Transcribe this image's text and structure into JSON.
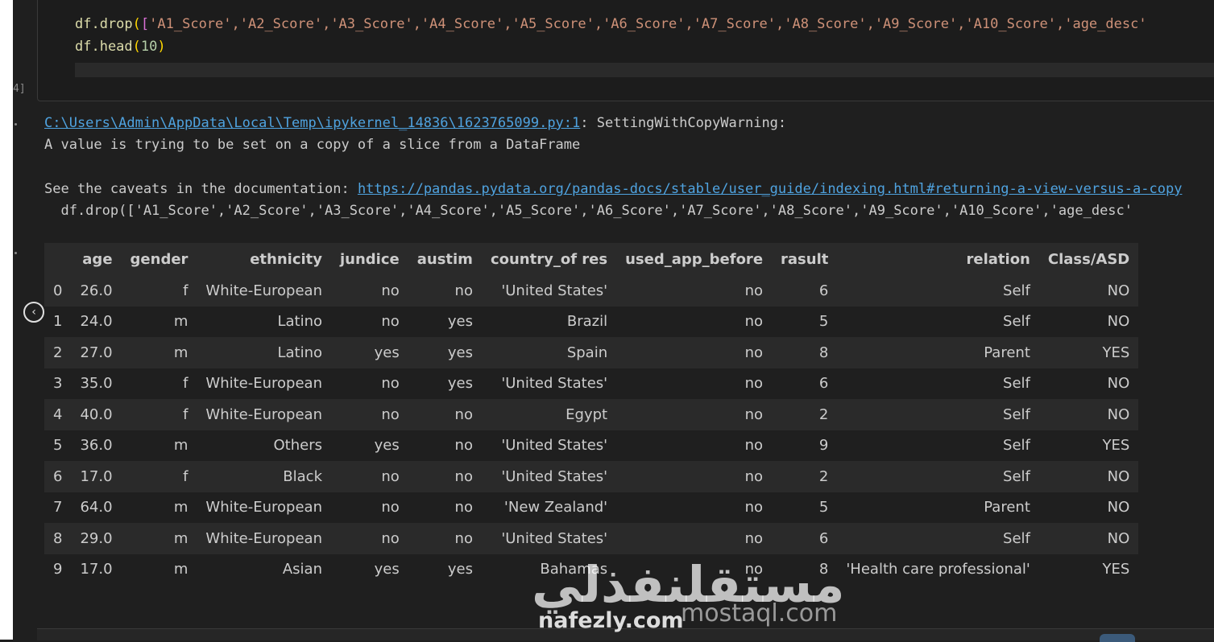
{
  "code": {
    "line1_fn": "df.drop",
    "line1_args": "'A1_Score','A2_Score','A3_Score','A4_Score','A5_Score','A6_Score','A7_Score','A8_Score','A9_Score','A10_Score','age_desc'",
    "line2_fn": "df.head",
    "line2_arg": "10"
  },
  "execution_count": "4]",
  "output": {
    "warning_link": "C:\\Users\\Admin\\AppData\\Local\\Temp\\ipykernel_14836\\1623765099.py:1",
    "warning_title": ": SettingWithCopyWarning:",
    "warning_msg": "A value is trying to be set on a copy of a slice from a DataFrame",
    "caveats_text": "See the caveats in the documentation: ",
    "caveats_link": "https://pandas.pydata.org/pandas-docs/stable/user_guide/indexing.html#returning-a-view-versus-a-copy",
    "source_line": "  df.drop(['A1_Score','A2_Score','A3_Score','A4_Score','A5_Score','A6_Score','A7_Score','A8_Score','A9_Score','A10_Score','age_desc'"
  },
  "table": {
    "columns": [
      "",
      "age",
      "gender",
      "ethnicity",
      "jundice",
      "austim",
      "country_of res",
      "used_app_before",
      "rasult",
      "relation",
      "Class/ASD"
    ],
    "rows": [
      [
        "0",
        "26.0",
        "f",
        "White-European",
        "no",
        "no",
        "'United States'",
        "no",
        "6",
        "Self",
        "NO"
      ],
      [
        "1",
        "24.0",
        "m",
        "Latino",
        "no",
        "yes",
        "Brazil",
        "no",
        "5",
        "Self",
        "NO"
      ],
      [
        "2",
        "27.0",
        "m",
        "Latino",
        "yes",
        "yes",
        "Spain",
        "no",
        "8",
        "Parent",
        "YES"
      ],
      [
        "3",
        "35.0",
        "f",
        "White-European",
        "no",
        "yes",
        "'United States'",
        "no",
        "6",
        "Self",
        "NO"
      ],
      [
        "4",
        "40.0",
        "f",
        "White-European",
        "no",
        "no",
        "Egypt",
        "no",
        "2",
        "Self",
        "NO"
      ],
      [
        "5",
        "36.0",
        "m",
        "Others",
        "yes",
        "no",
        "'United States'",
        "no",
        "9",
        "Self",
        "YES"
      ],
      [
        "6",
        "17.0",
        "f",
        "Black",
        "no",
        "no",
        "'United States'",
        "no",
        "2",
        "Self",
        "NO"
      ],
      [
        "7",
        "64.0",
        "m",
        "White-European",
        "no",
        "no",
        "'New Zealand'",
        "no",
        "5",
        "Parent",
        "NO"
      ],
      [
        "8",
        "29.0",
        "m",
        "White-European",
        "no",
        "no",
        "'United States'",
        "no",
        "6",
        "Self",
        "NO"
      ],
      [
        "9",
        "17.0",
        "m",
        "Asian",
        "yes",
        "yes",
        "Bahamas",
        "no",
        "8",
        "'Health care professional'",
        "YES"
      ]
    ]
  },
  "watermark": {
    "arabic": "مستقلنفذلي",
    "nafezly": "nafezly.com",
    "mostaql": "mostaql.com"
  },
  "icons": {
    "collapse": "chevron-left-icon"
  }
}
